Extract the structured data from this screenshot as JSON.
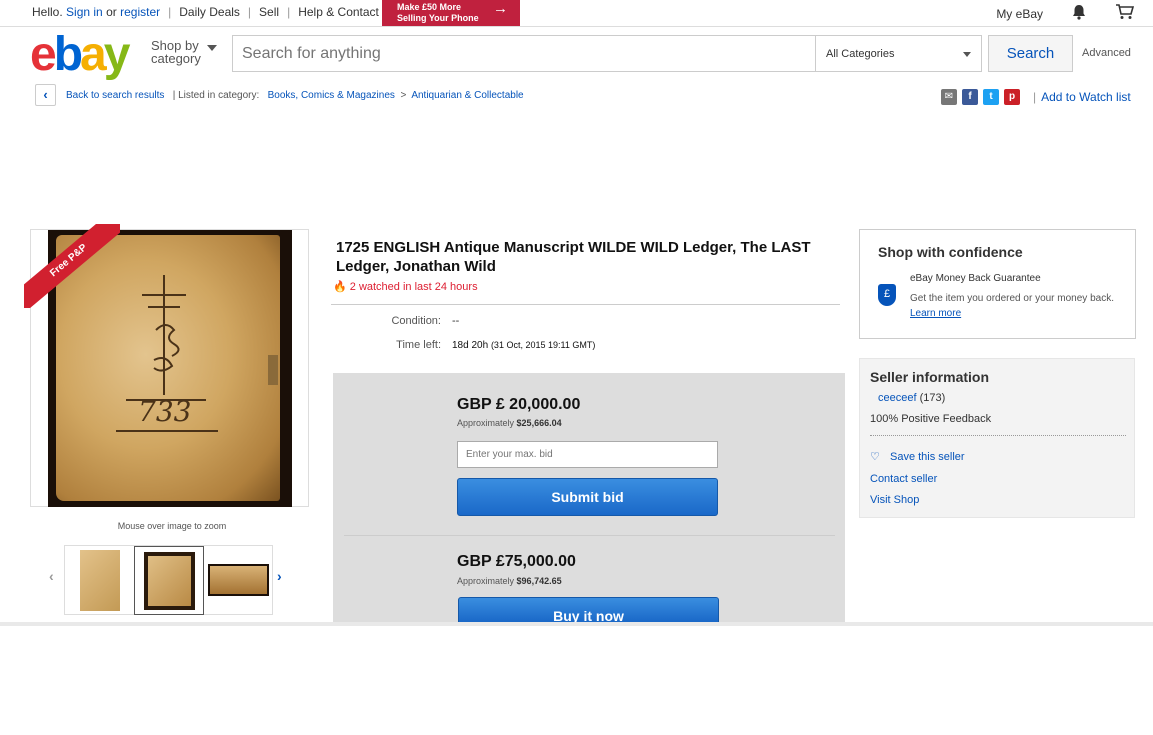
{
  "topbar": {
    "hello": "Hello.",
    "signin": "Sign in",
    "or": "or",
    "register": "register",
    "daily_deals": "Daily Deals",
    "sell": "Sell",
    "help": "Help & Contact",
    "promo_line1": "Make £50 More",
    "promo_line2": "Selling Your Phone",
    "my_ebay": "My eBay",
    "bell_icon": "bell-icon",
    "cart_icon": "cart-icon"
  },
  "header": {
    "logo": [
      "e",
      "b",
      "a",
      "y"
    ],
    "shop_by_line1": "Shop by",
    "shop_by_line2": "category",
    "search_placeholder": "Search for anything",
    "category_value": "All Categories",
    "search_button": "Search",
    "advanced": "Advanced"
  },
  "breadcrumb": {
    "back": "Back to search results",
    "listed_in": "| Listed in category:",
    "cat1": "Books, Comics & Magazines",
    "sep": ">",
    "cat2": "Antiquarian & Collectable",
    "add_watch": "Add to Watch list"
  },
  "gallery": {
    "ribbon": "Free P&P",
    "zoom_hint": "Mouse over image to zoom",
    "book_mark": "733"
  },
  "item": {
    "title": "1725 ENGLISH Antique Manuscript WILDE WILD Ledger, The LAST Ledger, Jonathan Wild",
    "watched": "2 watched in last 24 hours",
    "condition_label": "Condition:",
    "condition_value": "--",
    "time_left_label": "Time left:",
    "time_left_value": "18d 20h",
    "time_left_detail": "(31 Oct, 2015 19:11 GMT)"
  },
  "bidding": {
    "bid_price": "GBP £ 20,000.00",
    "bid_approx_label": "Approximately",
    "bid_approx_value": "$25,666.04",
    "bid_placeholder": "Enter your max. bid",
    "submit_bid": "Submit bid",
    "bin_price": "GBP £75,000.00",
    "bin_approx_label": "Approximately",
    "bin_approx_value": "$96,742.65",
    "buy_now": "Buy it now"
  },
  "confidence": {
    "heading": "Shop with confidence",
    "shield_glyph": "£",
    "guarantee": "eBay Money Back Guarantee",
    "desc": "Get the item you ordered or your money back.",
    "learn_more": "Learn more"
  },
  "seller": {
    "heading": "Seller information",
    "name": "ceeceef",
    "score": "(173)",
    "feedback": "100% Positive Feedback",
    "save": "Save this seller",
    "contact": "Contact seller",
    "visit": "Visit Shop"
  },
  "colors": {
    "link": "#0654ba",
    "promo": "#c0213e",
    "watched": "#dd1e31",
    "button": "#1a68c8"
  }
}
